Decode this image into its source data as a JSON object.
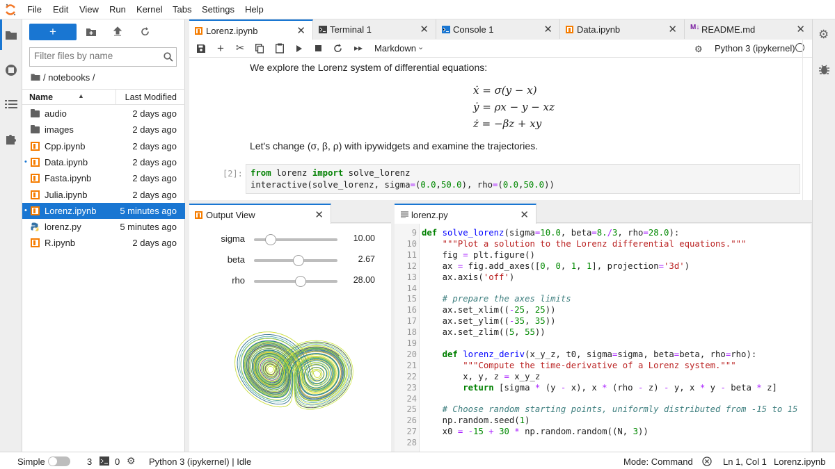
{
  "menubar": {
    "logo": "jupyter-logo",
    "items": [
      "File",
      "Edit",
      "View",
      "Run",
      "Kernel",
      "Tabs",
      "Settings",
      "Help"
    ]
  },
  "left_sidebar": {
    "icons": [
      "folder-icon",
      "stop-circle-icon",
      "list-icon",
      "puzzle-icon"
    ]
  },
  "right_sidebar": {
    "icons": [
      "gears-icon",
      "bug-icon"
    ]
  },
  "file_browser": {
    "new_button_label": "+",
    "filter_placeholder": "Filter files by name",
    "breadcrumb": "/ notebooks /",
    "col_name": "Name",
    "col_modified": "Last Modified",
    "files": [
      {
        "name": "audio",
        "modified": "2 days ago",
        "kind": "folder",
        "running": false,
        "selected": false
      },
      {
        "name": "images",
        "modified": "2 days ago",
        "kind": "folder",
        "running": false,
        "selected": false
      },
      {
        "name": "Cpp.ipynb",
        "modified": "2 days ago",
        "kind": "notebook",
        "running": false,
        "selected": false
      },
      {
        "name": "Data.ipynb",
        "modified": "2 days ago",
        "kind": "notebook",
        "running": true,
        "selected": false
      },
      {
        "name": "Fasta.ipynb",
        "modified": "2 days ago",
        "kind": "notebook",
        "running": false,
        "selected": false
      },
      {
        "name": "Julia.ipynb",
        "modified": "2 days ago",
        "kind": "notebook",
        "running": false,
        "selected": false
      },
      {
        "name": "Lorenz.ipynb",
        "modified": "5 minutes ago",
        "kind": "notebook",
        "running": true,
        "selected": true
      },
      {
        "name": "lorenz.py",
        "modified": "5 minutes ago",
        "kind": "python",
        "running": false,
        "selected": false
      },
      {
        "name": "R.ipynb",
        "modified": "2 days ago",
        "kind": "notebook",
        "running": false,
        "selected": false
      }
    ]
  },
  "top_tabs": [
    {
      "label": "Lorenz.ipynb",
      "icon": "notebook-icon",
      "active": true
    },
    {
      "label": "Terminal 1",
      "icon": "terminal-icon",
      "active": false
    },
    {
      "label": "Console 1",
      "icon": "console-icon",
      "active": false
    },
    {
      "label": "Data.ipynb",
      "icon": "notebook-icon",
      "active": false
    },
    {
      "label": "README.md",
      "icon": "markdown-icon",
      "active": false
    }
  ],
  "notebook": {
    "cell_type": "Markdown",
    "kernel": "Python 3 (ipykernel)",
    "intro": "We explore the Lorenz system of differential equations:",
    "eq1": "ẋ = σ(y − x)",
    "eq2": "ẏ = ρx − y − xz",
    "eq3": "ż = −βz + xy",
    "change_text": "Let's change (σ, β, ρ) with ipywidgets and examine the trajectories.",
    "prompt": "[2]:",
    "code_line1": "from lorenz import solve_lorenz",
    "code_line2": "interactive(solve_lorenz, sigma=(0.0,50.0), rho=(0.0,50.0))"
  },
  "output_view": {
    "tab_label": "Output View",
    "sliders": [
      {
        "label": "sigma",
        "value": "10.00",
        "fraction": 0.2
      },
      {
        "label": "beta",
        "value": "2.67",
        "fraction": 0.53
      },
      {
        "label": "rho",
        "value": "28.00",
        "fraction": 0.56
      }
    ]
  },
  "editor": {
    "tab_label": "lorenz.py",
    "first_line": 9,
    "lines": [
      "def solve_lorenz(sigma=10.0, beta=8./3, rho=28.0):",
      "    \"\"\"Plot a solution to the Lorenz differential equations.\"\"\"",
      "    fig = plt.figure()",
      "    ax = fig.add_axes([0, 0, 1, 1], projection='3d')",
      "    ax.axis('off')",
      "",
      "    # prepare the axes limits",
      "    ax.set_xlim((-25, 25))",
      "    ax.set_ylim((-35, 35))",
      "    ax.set_zlim((5, 55))",
      "",
      "    def lorenz_deriv(x_y_z, t0, sigma=sigma, beta=beta, rho=rho):",
      "        \"\"\"Compute the time-derivative of a Lorenz system.\"\"\"",
      "        x, y, z = x_y_z",
      "        return [sigma * (y - x), x * (rho - z) - y, x * y - beta * z]",
      "",
      "    # Choose random starting points, uniformly distributed from -15 to 15",
      "    np.random.seed(1)",
      "    x0 = -15 + 30 * np.random.random((N, 3))",
      ""
    ]
  },
  "status": {
    "mode_label": "Simple",
    "terminals": "3",
    "kernels": "0",
    "kernel_state": "Python 3 (ipykernel) | Idle",
    "mode": "Mode: Command",
    "cursor": "Ln 1, Col 1",
    "filename": "Lorenz.ipynb"
  },
  "colors": {
    "accent": "#1976d2",
    "notebook_orange": "#f57c00"
  }
}
